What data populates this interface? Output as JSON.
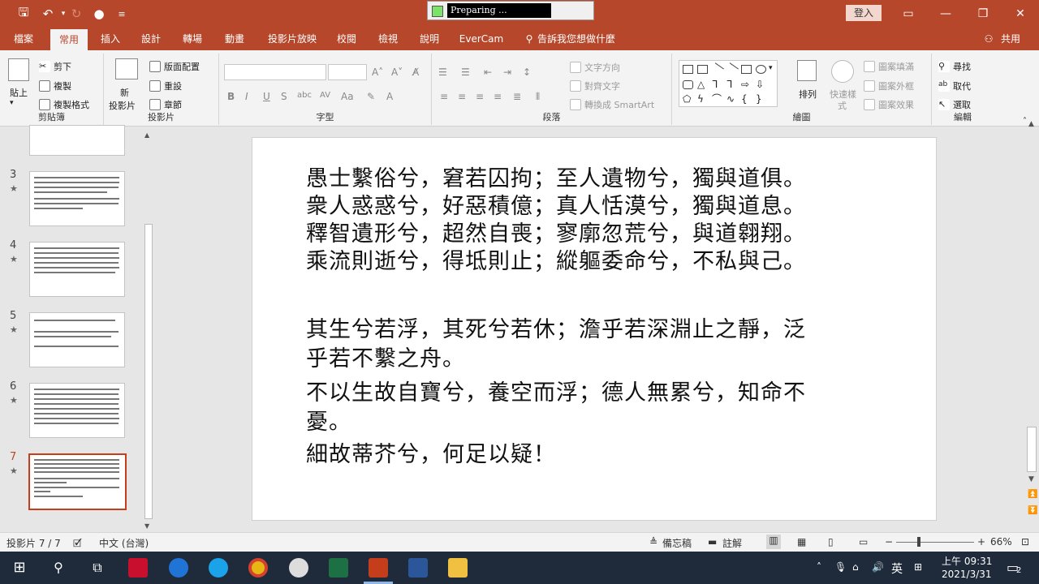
{
  "titlebar": {
    "progress_text": "Preparing ...",
    "sign_in": "登入",
    "bg_color": "#b7472a"
  },
  "tabs": [
    "檔案",
    "常用",
    "插入",
    "設計",
    "轉場",
    "動畫",
    "投影片放映",
    "校閱",
    "檢視",
    "說明",
    "EverCam",
    "告訴我您想做什麼",
    "共用"
  ],
  "ribbon": {
    "clipboard": {
      "paste": "貼上",
      "cut": "剪下",
      "copy": "複製",
      "format_painter": "複製格式",
      "label": "剪貼簿"
    },
    "slides": {
      "new_slide_1": "新",
      "new_slide_2": "投影片",
      "layout": "版面配置",
      "reset": "重設",
      "section": "章節",
      "label": "投影片"
    },
    "font": {
      "label": "字型"
    },
    "paragraph": {
      "text_direction": "文字方向",
      "align_text": "對齊文字",
      "smartart": "轉換成 SmartArt",
      "label": "段落"
    },
    "drawing": {
      "arrange": "排列",
      "quick_styles_1": "快速樣",
      "quick_styles_2": "式",
      "shape_fill": "圖案填滿",
      "shape_outline": "圖案外框",
      "shape_effects": "圖案效果",
      "label": "繪圖"
    },
    "editing": {
      "find": "尋找",
      "replace": "取代",
      "select": "選取",
      "label": "編輯"
    }
  },
  "thumbnails": [
    {
      "num": "3",
      "star": "★"
    },
    {
      "num": "4",
      "star": "★"
    },
    {
      "num": "5",
      "star": "★"
    },
    {
      "num": "6",
      "star": "★"
    },
    {
      "num": "7",
      "star": "★"
    }
  ],
  "slide": {
    "lines": [
      "愚士繫俗兮，窘若囚拘；至人遺物兮，獨與道俱。",
      "衆人惑惑兮，好惡積億；真人恬漠兮，獨與道息。",
      "釋智遺形兮，超然自喪；寥廓忽荒兮，與道翱翔。",
      "乘流則逝兮，得坻則止；縱軀委命兮，不私與己。",
      "其生兮若浮，其死兮若休；澹乎若深淵止之靜，泛",
      "乎若不繫之舟。",
      "不以生故自寶兮，養空而浮；德人無累兮，知命不",
      "憂。",
      "細故蒂芥兮，何足以疑！"
    ]
  },
  "status": {
    "slide_count": "投影片 7 / 7",
    "language": "中文 (台灣)",
    "notes": "備忘稿",
    "comments": "註解",
    "zoom": "66%"
  },
  "taskbar": {
    "ime": "英",
    "time": "上午 09:31",
    "date": "2021/3/31",
    "notif_count": "2"
  }
}
